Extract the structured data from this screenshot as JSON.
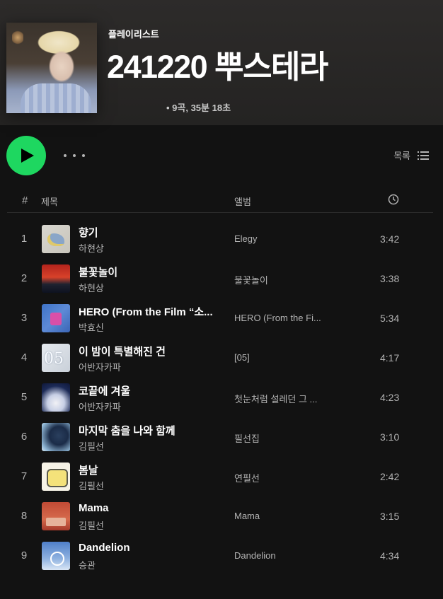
{
  "playlist": {
    "type_label": "플레이리스트",
    "title": "241220 뿌스테라",
    "meta": "• 9곡, 35분 18초"
  },
  "controls": {
    "list_view_label": "목록"
  },
  "columns": {
    "number": "#",
    "title": "제목",
    "album": "앨범"
  },
  "tracks": [
    {
      "num": "1",
      "title": "향기",
      "artist": "하현상",
      "album": "Elegy",
      "duration": "3:42"
    },
    {
      "num": "2",
      "title": "불꽃놀이",
      "artist": "하현상",
      "album": "불꽃놀이",
      "duration": "3:38"
    },
    {
      "num": "3",
      "title": "HERO (From the Film “소...",
      "artist": "박효신",
      "album": "HERO (From the Fi...",
      "duration": "5:34"
    },
    {
      "num": "4",
      "title": "이 밤이 특별해진 건",
      "artist": "어반자카파",
      "album": "[05]",
      "duration": "4:17"
    },
    {
      "num": "5",
      "title": "코끝에 겨울",
      "artist": "어반자카파",
      "album": "첫눈처럼 설레던 그 ...",
      "duration": "4:23"
    },
    {
      "num": "6",
      "title": "마지막 춤을 나와 함께",
      "artist": "김필선",
      "album": "필선집",
      "duration": "3:10"
    },
    {
      "num": "7",
      "title": "봄날",
      "artist": "김필선",
      "album": "연필선",
      "duration": "2:42"
    },
    {
      "num": "8",
      "title": "Mama",
      "artist": "김필선",
      "album": "Mama",
      "duration": "3:15"
    },
    {
      "num": "9",
      "title": "Dandelion",
      "artist": "승관",
      "album": "Dandelion",
      "duration": "4:34"
    }
  ],
  "colors": {
    "accent": "#1ed760",
    "background": "#121212",
    "header": "#2d2b2a",
    "secondary_text": "#b3b3b3"
  },
  "icons": [
    "play-icon",
    "more-options-icon",
    "list-view-icon",
    "clock-icon"
  ]
}
